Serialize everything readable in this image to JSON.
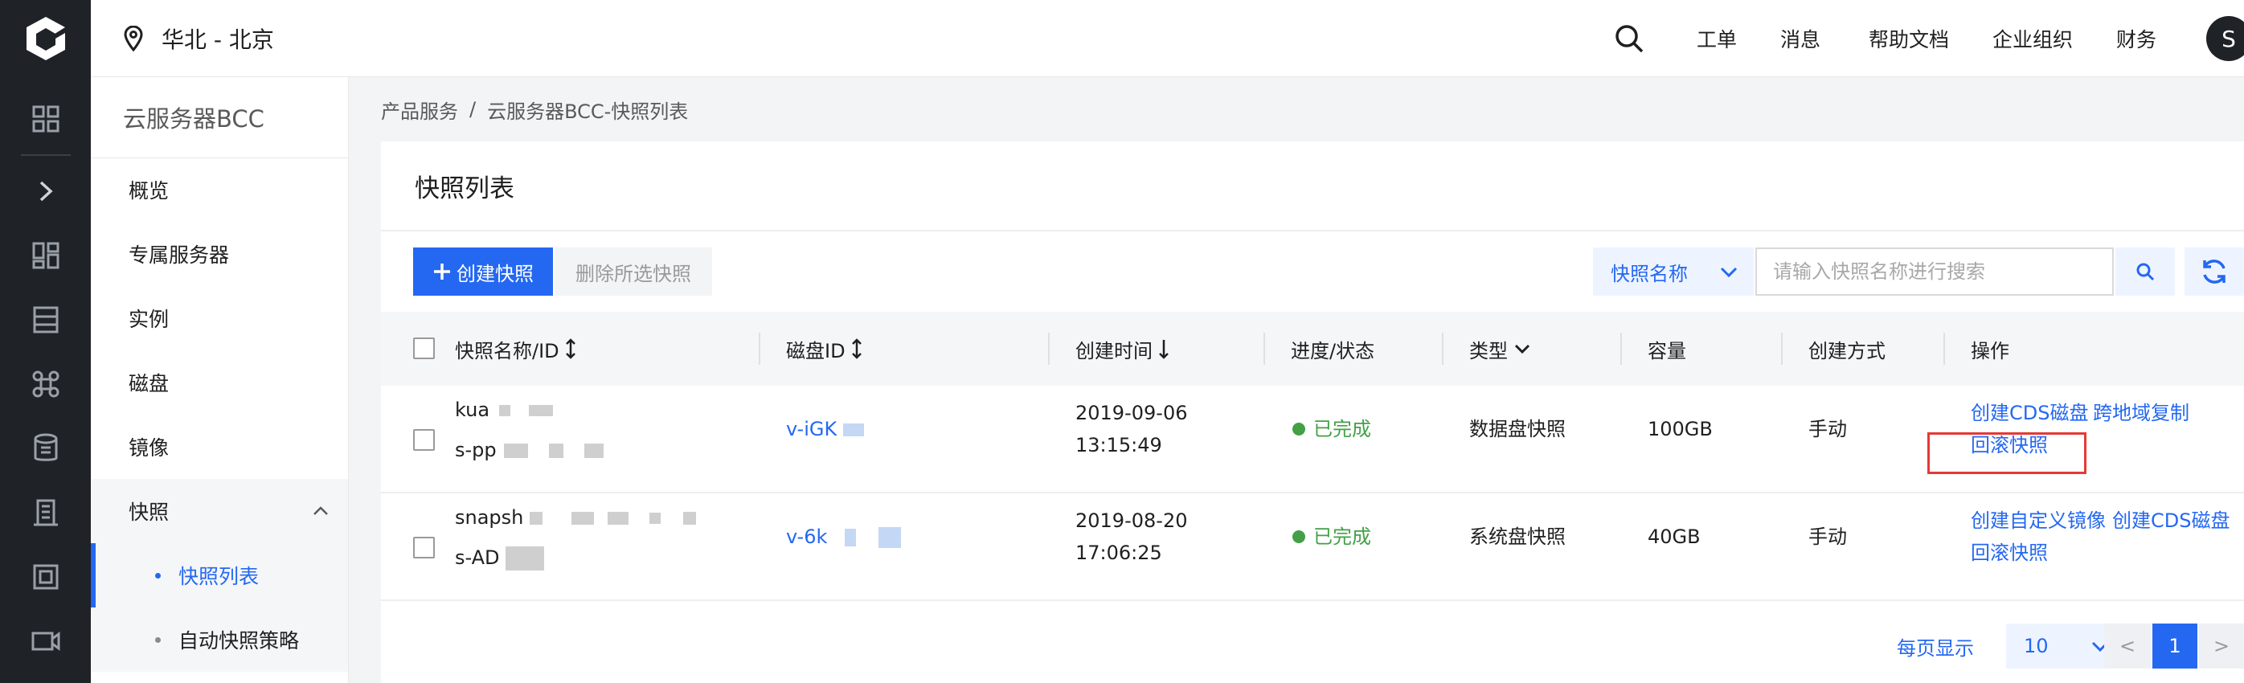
{
  "topbar": {
    "region": "华北 - 北京",
    "nav": [
      "工单",
      "消息",
      "帮助文档",
      "企业组织",
      "财务"
    ],
    "avatar_initial": "S"
  },
  "sidebar": {
    "title": "云服务器BCC",
    "items": [
      "概览",
      "专属服务器",
      "实例",
      "磁盘",
      "镜像"
    ],
    "group": "快照",
    "subitems": [
      "快照列表",
      "自动快照策略"
    ],
    "active_subitem": "快照列表"
  },
  "breadcrumb": {
    "parent": "产品服务",
    "separator": "/",
    "current": "云服务器BCC-快照列表"
  },
  "page": {
    "title": "快照列表",
    "create_button": "创建快照",
    "delete_button": "删除所选快照",
    "filter_select": "快照名称",
    "search_placeholder": "请输入快照名称进行搜索"
  },
  "table": {
    "columns": {
      "name": "快照名称/ID",
      "disk": "磁盘ID",
      "created": "创建时间",
      "status": "进度/状态",
      "type": "类型",
      "capacity": "容量",
      "method": "创建方式",
      "actions": "操作"
    },
    "rows": [
      {
        "name": "kua",
        "id": "s-pp",
        "disk": "v-iGK",
        "date": "2019-09-06",
        "time": "13:15:49",
        "status": "已完成",
        "type": "数据盘快照",
        "capacity": "100GB",
        "method": "手动",
        "actions": [
          "创建CDS磁盘",
          "跨地域复制",
          "回滚快照"
        ]
      },
      {
        "name": "snapsh",
        "id": "s-AD",
        "disk": "v-6k",
        "date": "2019-08-20",
        "time": "17:06:25",
        "status": "已完成",
        "type": "系统盘快照",
        "capacity": "40GB",
        "method": "手动",
        "actions": [
          "创建自定义镜像",
          "创建CDS磁盘",
          "回滚快照"
        ]
      }
    ]
  },
  "pagination": {
    "label": "每页显示",
    "page_size": "10",
    "prev": "<",
    "current_page": "1",
    "next": ">"
  },
  "colors": {
    "primary": "#2468f2",
    "success": "#43a047",
    "highlight": "#e53935",
    "rail": "#1f2227"
  }
}
